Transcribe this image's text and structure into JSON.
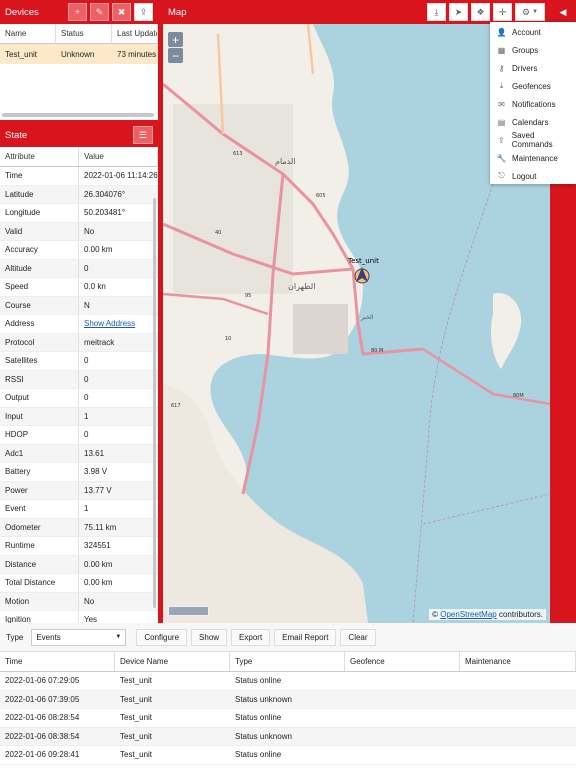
{
  "devices": {
    "title": "Devices",
    "columns": [
      "Name",
      "Status",
      "Last Update"
    ],
    "rows": [
      {
        "name": "Test_unit",
        "status": "Unknown",
        "last_update": "73 minutes"
      }
    ]
  },
  "state": {
    "title": "State",
    "columns": [
      "Attribute",
      "Value"
    ],
    "rows": [
      {
        "attr": "Time",
        "value": "2022-01-06 11:14:26"
      },
      {
        "attr": "Latitude",
        "value": "26.304076°"
      },
      {
        "attr": "Longitude",
        "value": "50.203481°"
      },
      {
        "attr": "Valid",
        "value": "No"
      },
      {
        "attr": "Accuracy",
        "value": "0.00 km"
      },
      {
        "attr": "Altitude",
        "value": "0"
      },
      {
        "attr": "Speed",
        "value": "0.0 kn"
      },
      {
        "attr": "Course",
        "value": "N"
      },
      {
        "attr": "Address",
        "value": "Show Address"
      },
      {
        "attr": "Protocol",
        "value": "meitrack"
      },
      {
        "attr": "Satellites",
        "value": "0"
      },
      {
        "attr": "RSSI",
        "value": "0"
      },
      {
        "attr": "Output",
        "value": "0"
      },
      {
        "attr": "Input",
        "value": "1"
      },
      {
        "attr": "HDOP",
        "value": "0"
      },
      {
        "attr": "Adc1",
        "value": "13.61"
      },
      {
        "attr": "Battery",
        "value": "3.98 V"
      },
      {
        "attr": "Power",
        "value": "13.77 V"
      },
      {
        "attr": "Event",
        "value": "1"
      },
      {
        "attr": "Odometer",
        "value": "75.11 km"
      },
      {
        "attr": "Runtime",
        "value": "324551"
      },
      {
        "attr": "Distance",
        "value": "0.00 km"
      },
      {
        "attr": "Total Distance",
        "value": "0.00 km"
      },
      {
        "attr": "Motion",
        "value": "No"
      },
      {
        "attr": "Ignition",
        "value": "Yes"
      }
    ]
  },
  "map": {
    "title": "Map",
    "marker_label": "Test_unit",
    "zoom_in": "+",
    "zoom_out": "−",
    "attribution_prefix": "©",
    "attribution_link": "OpenStreetMap",
    "attribution_suffix": "contributors.",
    "place_labels": {
      "dammam": "الدمام",
      "dhahran": "الظهران",
      "khobar": "الخبر",
      "road_613": "613",
      "road_605": "605",
      "road_40": "40",
      "road_95": "95",
      "road_80m": "80 M",
      "road_80m_2": "80M",
      "road_10": "10",
      "road_617": "617"
    }
  },
  "menu": {
    "items": [
      {
        "icon": "user-icon",
        "label": "Account"
      },
      {
        "icon": "groups-icon",
        "label": "Groups"
      },
      {
        "icon": "drivers-icon",
        "label": "Drivers"
      },
      {
        "icon": "geofence-icon",
        "label": "Geofences"
      },
      {
        "icon": "envelope-icon",
        "label": "Notifications"
      },
      {
        "icon": "calendar-icon",
        "label": "Calendars"
      },
      {
        "icon": "upload-icon",
        "label": "Saved Commands"
      },
      {
        "icon": "wrench-icon",
        "label": "Maintenance"
      },
      {
        "icon": "logout-icon",
        "label": "Logout"
      }
    ]
  },
  "events": {
    "type_label": "Type",
    "type_value": "Events",
    "buttons": [
      "Configure",
      "Show",
      "Export",
      "Email Report",
      "Clear"
    ],
    "columns": [
      "Time",
      "Device Name",
      "Type",
      "Geofence",
      "Maintenance"
    ],
    "rows": [
      {
        "time": "2022-01-06 07:29:05",
        "device": "Test_unit",
        "type": "Status online"
      },
      {
        "time": "2022-01-06 07:39:05",
        "device": "Test_unit",
        "type": "Status unknown"
      },
      {
        "time": "2022-01-06 08:28:54",
        "device": "Test_unit",
        "type": "Status online"
      },
      {
        "time": "2022-01-06 08:38:54",
        "device": "Test_unit",
        "type": "Status unknown"
      },
      {
        "time": "2022-01-06 09:28:41",
        "device": "Test_unit",
        "type": "Status online"
      }
    ]
  },
  "colors": {
    "accent": "#d8141c",
    "selected_row": "#fde9c8",
    "water": "#aad3df",
    "land": "#f2efe9"
  }
}
